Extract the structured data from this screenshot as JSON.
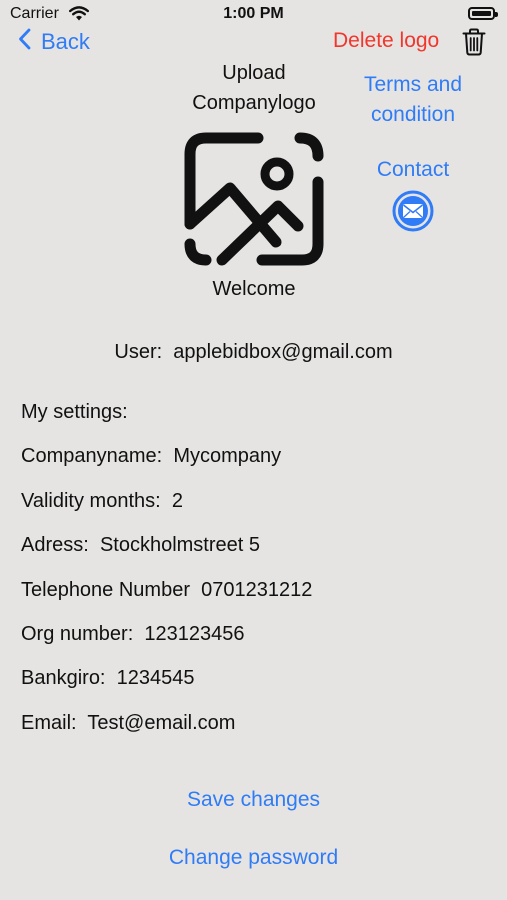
{
  "status_bar": {
    "carrier": "Carrier",
    "time": "1:00 PM",
    "wifi_icon": "wifi-icon",
    "battery_icon": "battery-icon"
  },
  "nav": {
    "back_label": "Back",
    "back_icon": "chevron-left-icon",
    "delete_logo_label": "Delete logo",
    "trash_icon": "trash-icon"
  },
  "logo": {
    "upload_line1": "Upload",
    "upload_line2": "Companylogo",
    "placeholder_icon": "photo-placeholder-icon",
    "welcome": "Welcome"
  },
  "links": {
    "terms_line1": "Terms and",
    "terms_line2": "condition",
    "contact": "Contact",
    "mail_icon": "envelope-icon"
  },
  "user": {
    "label": "User:",
    "email": "applebidbox@gmail.com"
  },
  "settings": {
    "heading": "My settings:",
    "rows": [
      {
        "label": "Companyname:",
        "value": "Mycompany"
      },
      {
        "label": "Validity months:",
        "value": "2"
      },
      {
        "label": "Adress:",
        "value": "Stockholmstreet 5"
      },
      {
        "label": "Telephone Number",
        "value": "0701231212"
      },
      {
        "label": "Org number:",
        "value": "123123456"
      },
      {
        "label": "Bankgiro:",
        "value": "1234545"
      },
      {
        "label": "Email:",
        "value": "Test@email.com"
      }
    ]
  },
  "actions": {
    "save_label": "Save changes",
    "change_password_label": "Change password"
  },
  "colors": {
    "background": "#e5e4e2",
    "link_blue": "#2f7cf6",
    "destructive_red": "#f2362c",
    "text": "#111111"
  }
}
